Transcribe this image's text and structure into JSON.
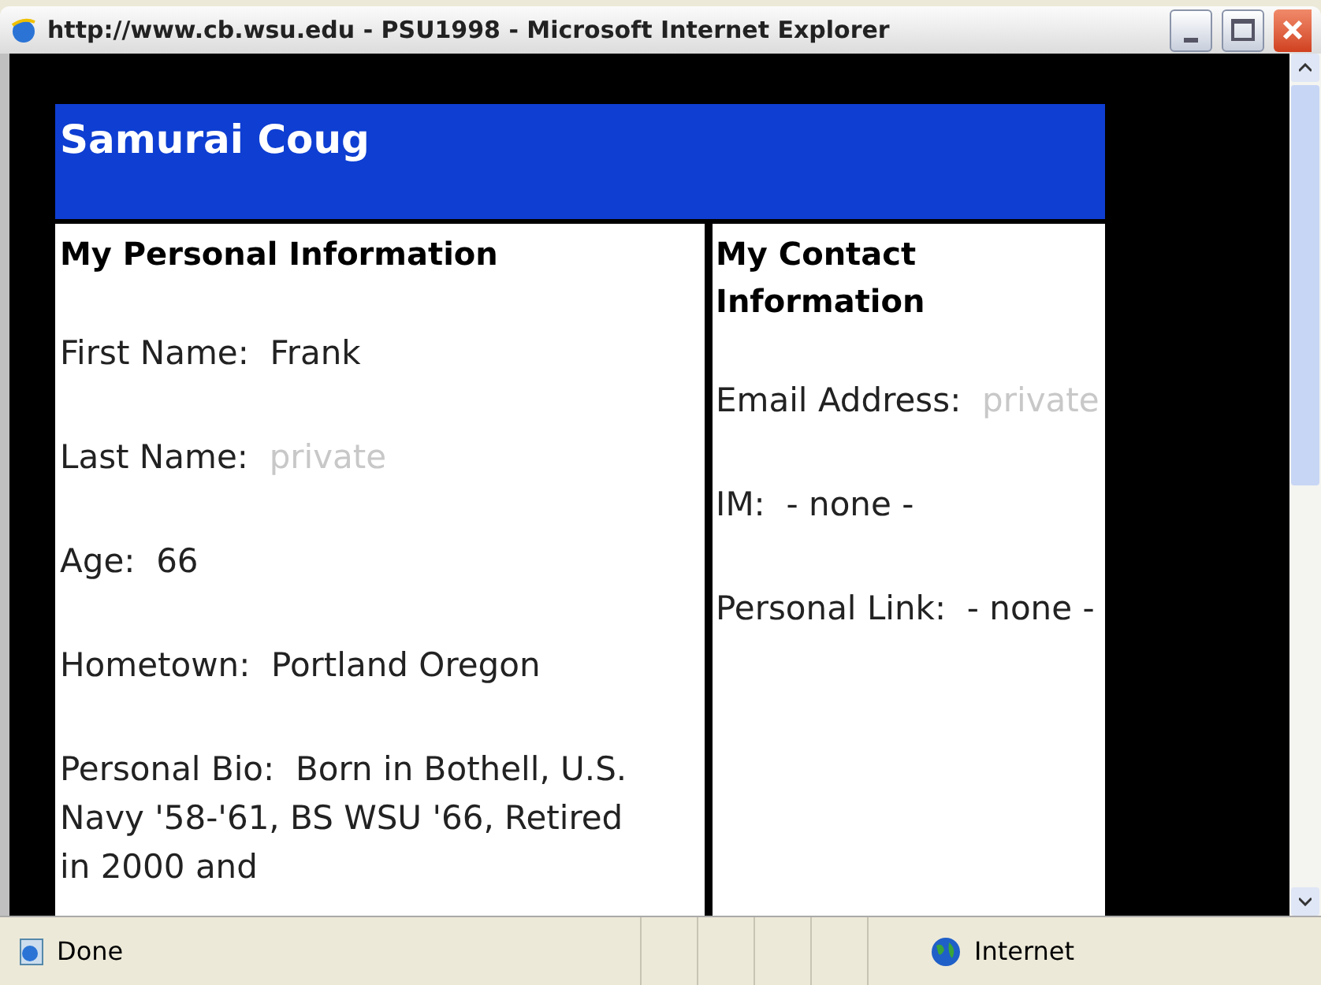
{
  "window": {
    "title": "http://www.cb.wsu.edu - PSU1998 - Microsoft Internet Explorer"
  },
  "profile": {
    "name": "Samurai Coug",
    "personal": {
      "heading": "My Personal Information",
      "fields": [
        {
          "label": "First Name:",
          "value": "Frank",
          "private": false
        },
        {
          "label": "Last Name:",
          "value": "private",
          "private": true
        },
        {
          "label": "Age:",
          "value": "66",
          "private": false
        },
        {
          "label": "Hometown:",
          "value": "Portland Oregon",
          "private": false
        },
        {
          "label": "Personal Bio:",
          "value": "Born in Bothell, U.S. Navy '58-'61, BS WSU '66, Retired in 2000 and",
          "private": false
        }
      ]
    },
    "contact": {
      "heading": "My Contact Information",
      "fields": [
        {
          "label": "Email Address:",
          "value": "private",
          "private": true
        },
        {
          "label": "IM:",
          "value": "- none -",
          "private": false
        },
        {
          "label": "Personal Link:",
          "value": "- none -",
          "private": false
        }
      ]
    }
  },
  "status_bar": {
    "status": "Done",
    "zone": "Internet"
  }
}
